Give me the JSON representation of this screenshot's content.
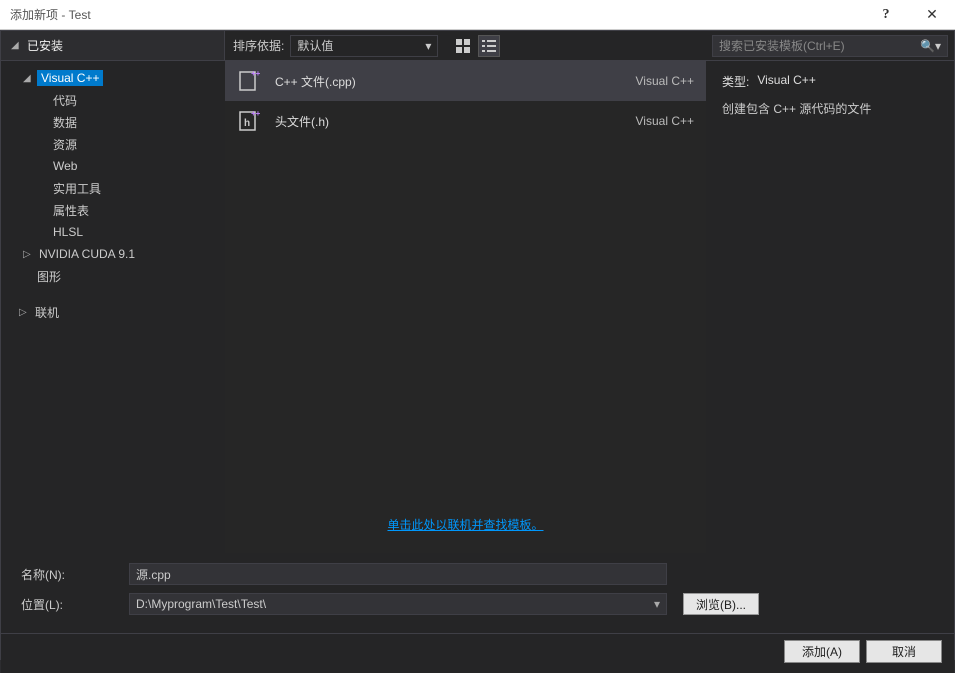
{
  "titlebar": {
    "title": "添加新项 - Test",
    "help": "?",
    "close": "✕"
  },
  "header": {
    "installed": "已安装",
    "sort_label": "排序依据:",
    "sort_value": "默认值",
    "search_placeholder": "搜索已安装模板(Ctrl+E)"
  },
  "sidebar": {
    "items": [
      {
        "label": "Visual C++",
        "level": 1,
        "arrow": "◢",
        "selected": true
      },
      {
        "label": "代码",
        "level": 2
      },
      {
        "label": "数据",
        "level": 2
      },
      {
        "label": "资源",
        "level": 2
      },
      {
        "label": "Web",
        "level": 2
      },
      {
        "label": "实用工具",
        "level": 2
      },
      {
        "label": "属性表",
        "level": 2
      },
      {
        "label": "HLSL",
        "level": 2
      },
      {
        "label": "NVIDIA CUDA 9.1",
        "level": 1,
        "arrow": "▷"
      },
      {
        "label": "图形",
        "level": 1,
        "noarrow": true
      }
    ],
    "online": {
      "label": "联机",
      "arrow": "▷"
    }
  },
  "templates": [
    {
      "name": "C++ 文件(.cpp)",
      "lang": "Visual C++",
      "icon": "cpp",
      "selected": true
    },
    {
      "name": "头文件(.h)",
      "lang": "Visual C++",
      "icon": "h",
      "selected": false
    }
  ],
  "online_link": "单击此处以联机并查找模板。",
  "detail": {
    "type_label": "类型:",
    "type_value": "Visual C++",
    "description": "创建包含 C++ 源代码的文件"
  },
  "form": {
    "name_label": "名称(N):",
    "name_value": "源.cpp",
    "location_label": "位置(L):",
    "location_value": "D:\\Myprogram\\Test\\Test\\",
    "browse_btn": "浏览(B)..."
  },
  "buttons": {
    "add": "添加(A)",
    "cancel": "取消"
  }
}
